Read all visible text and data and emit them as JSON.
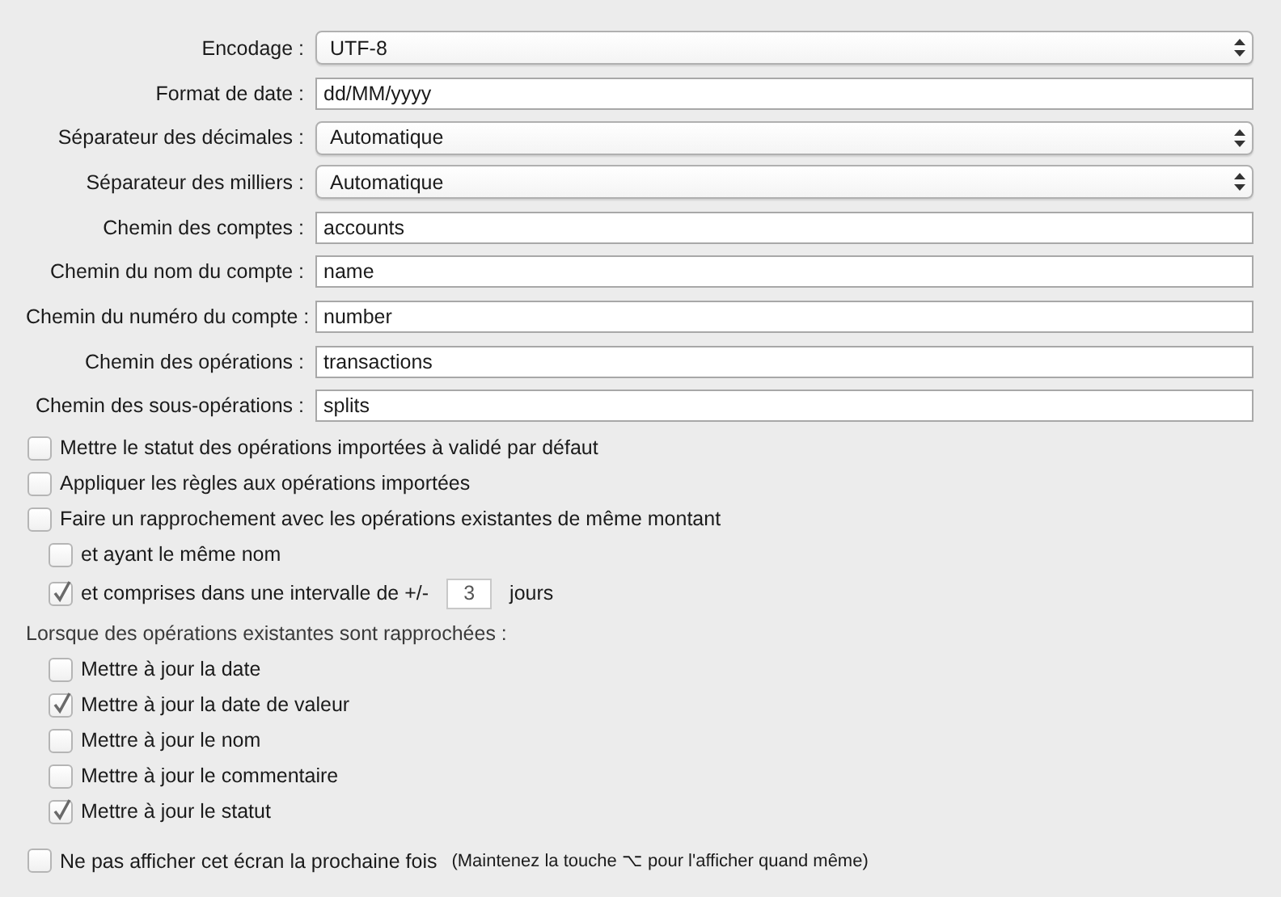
{
  "fields": [
    {
      "kind": "select",
      "label": "Encodage :",
      "value": "UTF-8"
    },
    {
      "kind": "text",
      "label": "Format de date :",
      "value": "dd/MM/yyyy"
    },
    {
      "kind": "select",
      "label": "Séparateur des décimales :",
      "value": "Automatique"
    },
    {
      "kind": "select",
      "label": "Séparateur des milliers :",
      "value": "Automatique"
    },
    {
      "kind": "text",
      "label": "Chemin des comptes :",
      "value": "accounts"
    },
    {
      "kind": "text",
      "label": "Chemin du nom du compte :",
      "value": "name"
    },
    {
      "kind": "text",
      "label": "Chemin du numéro du compte :",
      "value": "number"
    },
    {
      "kind": "text",
      "label": "Chemin des opérations :",
      "value": "transactions"
    },
    {
      "kind": "text",
      "label": "Chemin des sous-opérations :",
      "value": "splits"
    }
  ],
  "options": [
    {
      "kind": "checkbox",
      "label": "Mettre le statut des opérations importées à validé par défaut",
      "checked": false
    },
    {
      "kind": "checkbox",
      "label": "Appliquer les règles aux opérations importées",
      "checked": false
    },
    {
      "kind": "checkbox",
      "label": "Faire un rapprochement avec les opérations existantes de même montant",
      "checked": false,
      "children": [
        {
          "kind": "checkbox",
          "label": "et ayant le même nom",
          "checked": false
        },
        {
          "kind": "interval",
          "label": "et comprises dans une intervalle de +/-",
          "checked": true,
          "value": "3",
          "unit": "jours"
        }
      ]
    },
    {
      "kind": "heading",
      "label": "Lorsque des opérations existantes sont rapprochées :",
      "children": [
        {
          "kind": "checkbox",
          "label": "Mettre à jour la date",
          "checked": false
        },
        {
          "kind": "checkbox",
          "label": "Mettre à jour la date de valeur",
          "checked": true
        },
        {
          "kind": "checkbox",
          "label": "Mettre à jour le nom",
          "checked": false
        },
        {
          "kind": "checkbox",
          "label": "Mettre à jour le commentaire",
          "checked": false
        },
        {
          "kind": "checkbox",
          "label": "Mettre à jour le statut",
          "checked": true
        }
      ]
    }
  ],
  "footer": {
    "label": "Ne pas afficher cet écran la prochaine fois",
    "checked": false,
    "hint": "(Maintenez la touche ⌥ pour l'afficher quand même)"
  }
}
